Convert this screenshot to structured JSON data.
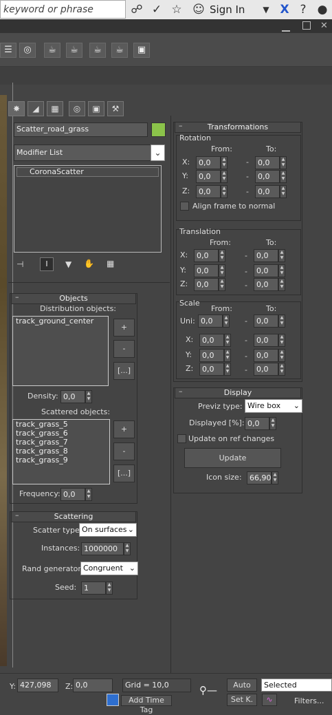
{
  "topbar": {
    "search_placeholder": "keyword or phrase",
    "signin": "Sign In",
    "icons": [
      "binoculars-icon",
      "satellite-icon",
      "star-icon",
      "user-icon",
      "help-icon",
      "exchange-icon",
      "help-icon"
    ]
  },
  "cmdpanel": {
    "object_name": "Scatter_road_grass",
    "object_color": "#8bc34a",
    "modifier_list": "Modifier List",
    "stack_items": [
      "CoronaScatter"
    ]
  },
  "objects": {
    "title": "Objects",
    "distribution_label": "Distribution objects:",
    "distribution_items": [
      "track_ground_center"
    ],
    "add": "+",
    "remove": "-",
    "more": "[...]",
    "density_label": "Density:",
    "density": "0,0",
    "scattered_label": "Scattered objects:",
    "scattered_items": [
      "track_grass_5",
      "track_grass_6",
      "track_grass_7",
      "track_grass_8",
      "track_grass_9"
    ],
    "frequency_label": "Frequency:",
    "frequency": "0,0"
  },
  "scattering": {
    "title": "Scattering",
    "scatter_type_label": "Scatter type:",
    "scatter_type": "On surfaces",
    "instances_label": "Instances:",
    "instances": "1000000",
    "rand_label": "Rand generator:",
    "rand": "Congruent",
    "seed_label": "Seed:",
    "seed": "1"
  },
  "transformations": {
    "title": "Transformations",
    "rotation": {
      "title": "Rotation",
      "from": "From:",
      "to": "To:",
      "x": "X:",
      "y": "Y:",
      "z": "Z:",
      "vals": [
        "0,0",
        "0,0",
        "0,0",
        "0,0",
        "0,0",
        "0,0"
      ]
    },
    "align_label": "Align frame to normal",
    "translation": {
      "title": "Translation",
      "from": "From:",
      "to": "To:",
      "x": "X:",
      "y": "Y:",
      "z": "Z:",
      "vals": [
        "0,0",
        "0,0",
        "0,0",
        "0,0",
        "0,0",
        "0,0"
      ]
    },
    "scale": {
      "title": "Scale",
      "from": "From:",
      "to": "To:",
      "uni": "Uni:",
      "x": "X:",
      "y": "Y:",
      "z": "Z:",
      "vals": [
        "0,0",
        "0,0",
        "0,0",
        "0,0",
        "0,0",
        "0,0",
        "0,0",
        "0,0"
      ]
    }
  },
  "display": {
    "title": "Display",
    "previz_label": "Previz type:",
    "previz": "Wire box",
    "displayed_label": "Displayed [%]:",
    "displayed": "0,0",
    "update_ref_label": "Update on ref changes",
    "update_button": "Update",
    "icon_size_label": "Icon size:",
    "icon_size": "66,90"
  },
  "status": {
    "y_label": "Y:",
    "y": "427,098",
    "z_label": "Z:",
    "z": "0,0",
    "grid": "Grid = 10,0",
    "auto": "Auto",
    "selected": "Selected",
    "setk": "Set K.",
    "filters": "Filters...",
    "add_time_tag": "Add Time Tag"
  }
}
